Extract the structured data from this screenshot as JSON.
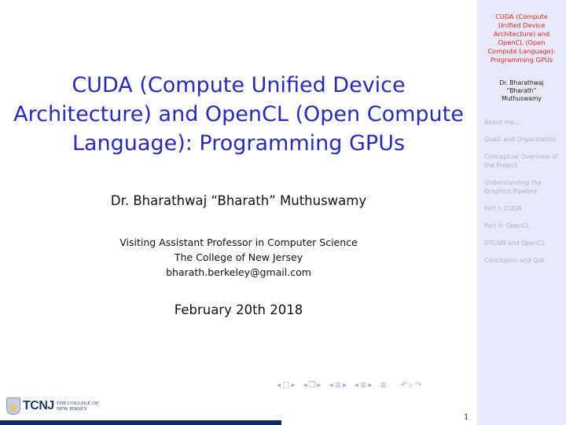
{
  "slide": {
    "title_lines": [
      "CUDA (Compute Unified Device",
      "Architecture) and OpenCL (Open Compute",
      "Language): Programming GPUs"
    ],
    "author": "Dr. Bharathwaj “Bharath” Muthuswamy",
    "institute_lines": [
      "Visiting Assistant Professor in Computer Science",
      "The College of New Jersey",
      "bharath.berkeley@gmail.com"
    ],
    "date": "February 20th 2018",
    "page_number": "1",
    "logo": {
      "abbrev": "TCNJ",
      "line1": "THE COLLEGE OF",
      "line2": "NEW JERSEY"
    }
  },
  "navigation_symbols": {
    "left_arrow": "◂",
    "right_arrow": "▸",
    "frame": "□",
    "subsection": "❐",
    "section": "≣",
    "doc": "≣",
    "back": "↶",
    "search": "⌕",
    "forward": "↷"
  },
  "sidebar": {
    "title_lines": [
      "CUDA (Compute",
      "Unified Device",
      "Architecture) and",
      "OpenCL (Open",
      "Compute Language):",
      "Programming GPUs"
    ],
    "author_lines": [
      "Dr. Bharathwaj",
      "“Bharath”",
      "Muthuswamy"
    ],
    "items": [
      {
        "label": "About me..."
      },
      {
        "label": "Goals and Organization"
      },
      {
        "label": "Conceptual Overview of the Project"
      },
      {
        "label": "Understanding the Graphics Pipeline"
      },
      {
        "label": "Part I: CUDA"
      },
      {
        "label": "Part II: OpenCL"
      },
      {
        "label": "DTCNN and OpenCL"
      },
      {
        "label": "Conclusion and Q/A"
      }
    ]
  },
  "colors": {
    "title": "#2b2bb0",
    "sidebar_title": "#e02828",
    "sidebar_bg": "#e8e8f6",
    "sidebar_item": "#b0b0dc",
    "bottom_bar": "#0b2c63"
  }
}
